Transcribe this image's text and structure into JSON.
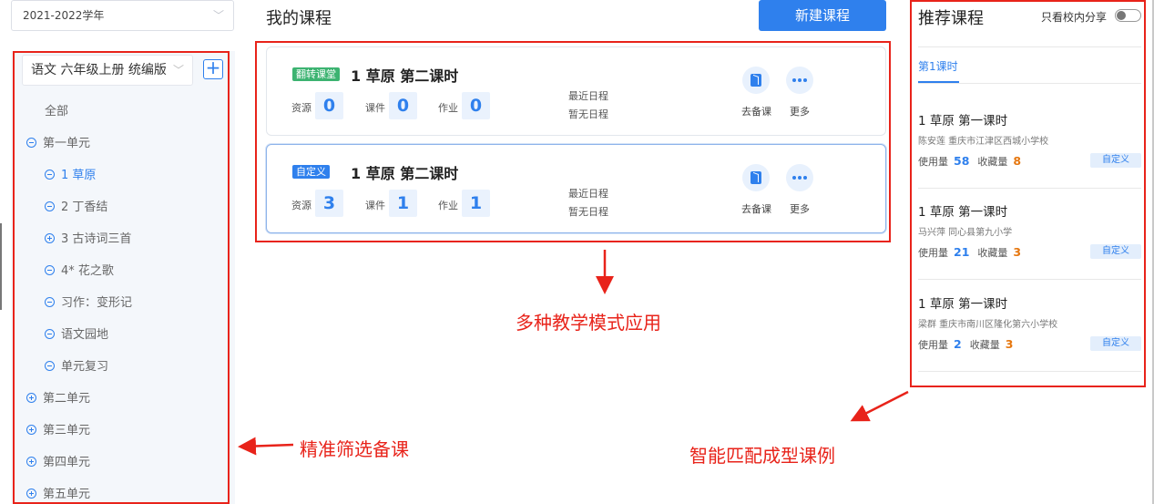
{
  "year_select": {
    "value": "2021-2022学年"
  },
  "book_select": {
    "value": "语文 六年级上册 统编版"
  },
  "add_label": "+",
  "tree": [
    {
      "label": "全部",
      "icon": "none",
      "state": "normal"
    },
    {
      "label": "第一单元",
      "icon": "minus-circle-icon",
      "state": "normal"
    },
    {
      "label": "1 草原",
      "icon": "minus-circle-icon",
      "state": "active"
    },
    {
      "label": "2 丁香结",
      "icon": "minus-circle-icon",
      "state": "normal"
    },
    {
      "label": "3 古诗词三首",
      "icon": "plus-circle-icon",
      "state": "normal"
    },
    {
      "label": "4* 花之歌",
      "icon": "minus-circle-icon",
      "state": "normal"
    },
    {
      "label": "习作：变形记",
      "icon": "minus-circle-icon",
      "state": "normal"
    },
    {
      "label": "语文园地",
      "icon": "minus-circle-icon",
      "state": "normal"
    },
    {
      "label": "单元复习",
      "icon": "minus-circle-icon",
      "state": "normal"
    },
    {
      "label": "第二单元",
      "icon": "plus-circle-icon",
      "state": "normal"
    },
    {
      "label": "第三单元",
      "icon": "plus-circle-icon",
      "state": "normal"
    },
    {
      "label": "第四单元",
      "icon": "plus-circle-icon",
      "state": "normal"
    },
    {
      "label": "第五单元",
      "icon": "plus-circle-icon",
      "state": "normal"
    }
  ],
  "main": {
    "title": "我的课程",
    "new_button": "新建课程",
    "courses": [
      {
        "tag": "翻转课堂",
        "tag_color": "#3cb371",
        "title": "1 草原 第二课时",
        "stats": [
          {
            "label": "资源",
            "value": "0"
          },
          {
            "label": "课件",
            "value": "0"
          },
          {
            "label": "作业",
            "value": "0"
          }
        ],
        "schedule_label": "最近日程",
        "schedule_value": "暂无日程",
        "actions": [
          {
            "label": "去备课",
            "icon": "prepare-lesson-icon"
          },
          {
            "label": "更多",
            "icon": "more-dots-icon"
          }
        ]
      },
      {
        "tag": "自定义",
        "tag_color": "#2f80ed",
        "title": "1 草原 第二课时",
        "stats": [
          {
            "label": "资源",
            "value": "3"
          },
          {
            "label": "课件",
            "value": "1"
          },
          {
            "label": "作业",
            "value": "1"
          }
        ],
        "schedule_label": "最近日程",
        "schedule_value": "暂无日程",
        "actions": [
          {
            "label": "去备课",
            "icon": "prepare-lesson-icon"
          },
          {
            "label": "更多",
            "icon": "more-dots-icon"
          }
        ]
      }
    ]
  },
  "recommend": {
    "title": "推荐课程",
    "share_label": "只看校内分享",
    "share_toggle": "off",
    "tab": "第1课时",
    "items": [
      {
        "title": "1 草原 第一课时",
        "meta": "陈安莲   重庆市江津区西城小学校",
        "use_label": "使用量",
        "use": "58",
        "fav_label": "收藏量",
        "fav": "8",
        "tag": "自定义"
      },
      {
        "title": "1 草原 第一课时",
        "meta": "马兴萍   同心县第九小学",
        "use_label": "使用量",
        "use": "21",
        "fav_label": "收藏量",
        "fav": "3",
        "tag": "自定义"
      },
      {
        "title": "1 草原 第一课时",
        "meta": "梁群   重庆市南川区隆化第六小学校",
        "use_label": "使用量",
        "use": "2",
        "fav_label": "收藏量",
        "fav": "3",
        "tag": "自定义"
      }
    ]
  },
  "annotations": {
    "middle": "多种教学模式应用",
    "left": "精准筛选备课",
    "right": "智能匹配成型课例",
    "color": "#e8231a"
  }
}
